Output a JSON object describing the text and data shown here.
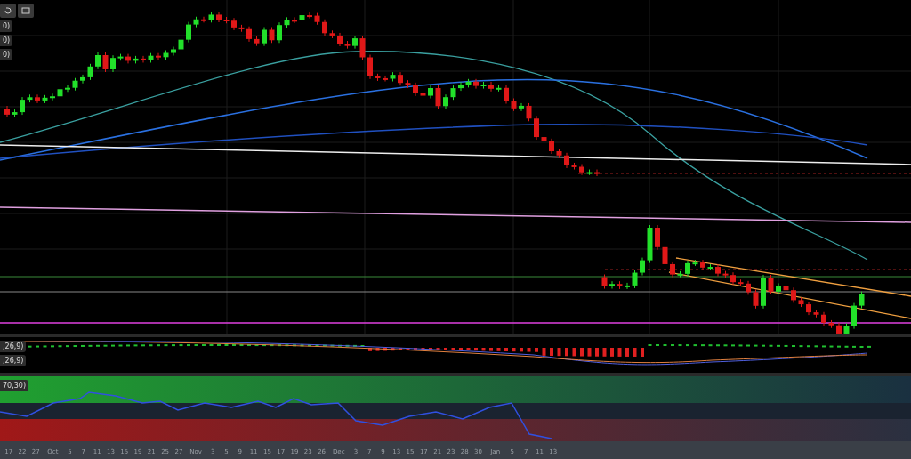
{
  "indicator_labels": [
    "0)",
    "0)",
    "0)"
  ],
  "macd_labels": [
    ",26,9)",
    ",26,9)"
  ],
  "rsi_label": "70,30)",
  "time_axis": [
    {
      "label": "17",
      "kind": "day"
    },
    {
      "label": "22",
      "kind": "day"
    },
    {
      "label": "27",
      "kind": "day"
    },
    {
      "label": "Oct",
      "kind": "month"
    },
    {
      "label": "5",
      "kind": "day"
    },
    {
      "label": "7",
      "kind": "day"
    },
    {
      "label": "11",
      "kind": "day"
    },
    {
      "label": "13",
      "kind": "day"
    },
    {
      "label": "15",
      "kind": "day"
    },
    {
      "label": "19",
      "kind": "day"
    },
    {
      "label": "21",
      "kind": "day"
    },
    {
      "label": "25",
      "kind": "day"
    },
    {
      "label": "27",
      "kind": "day"
    },
    {
      "label": "Nov",
      "kind": "month"
    },
    {
      "label": "3",
      "kind": "day"
    },
    {
      "label": "5",
      "kind": "day"
    },
    {
      "label": "9",
      "kind": "day"
    },
    {
      "label": "11",
      "kind": "day"
    },
    {
      "label": "15",
      "kind": "day"
    },
    {
      "label": "17",
      "kind": "day"
    },
    {
      "label": "19",
      "kind": "day"
    },
    {
      "label": "23",
      "kind": "day"
    },
    {
      "label": "26",
      "kind": "day"
    },
    {
      "label": "Dec",
      "kind": "month"
    },
    {
      "label": "3",
      "kind": "day"
    },
    {
      "label": "7",
      "kind": "day"
    },
    {
      "label": "9",
      "kind": "day"
    },
    {
      "label": "13",
      "kind": "day"
    },
    {
      "label": "15",
      "kind": "day"
    },
    {
      "label": "17",
      "kind": "day"
    },
    {
      "label": "21",
      "kind": "day"
    },
    {
      "label": "23",
      "kind": "day"
    },
    {
      "label": "28",
      "kind": "day"
    },
    {
      "label": "30",
      "kind": "day"
    },
    {
      "label": "Jan",
      "kind": "month"
    },
    {
      "label": "5",
      "kind": "day"
    },
    {
      "label": "7",
      "kind": "day"
    },
    {
      "label": "11",
      "kind": "day"
    },
    {
      "label": "13",
      "kind": "day"
    }
  ]
}
